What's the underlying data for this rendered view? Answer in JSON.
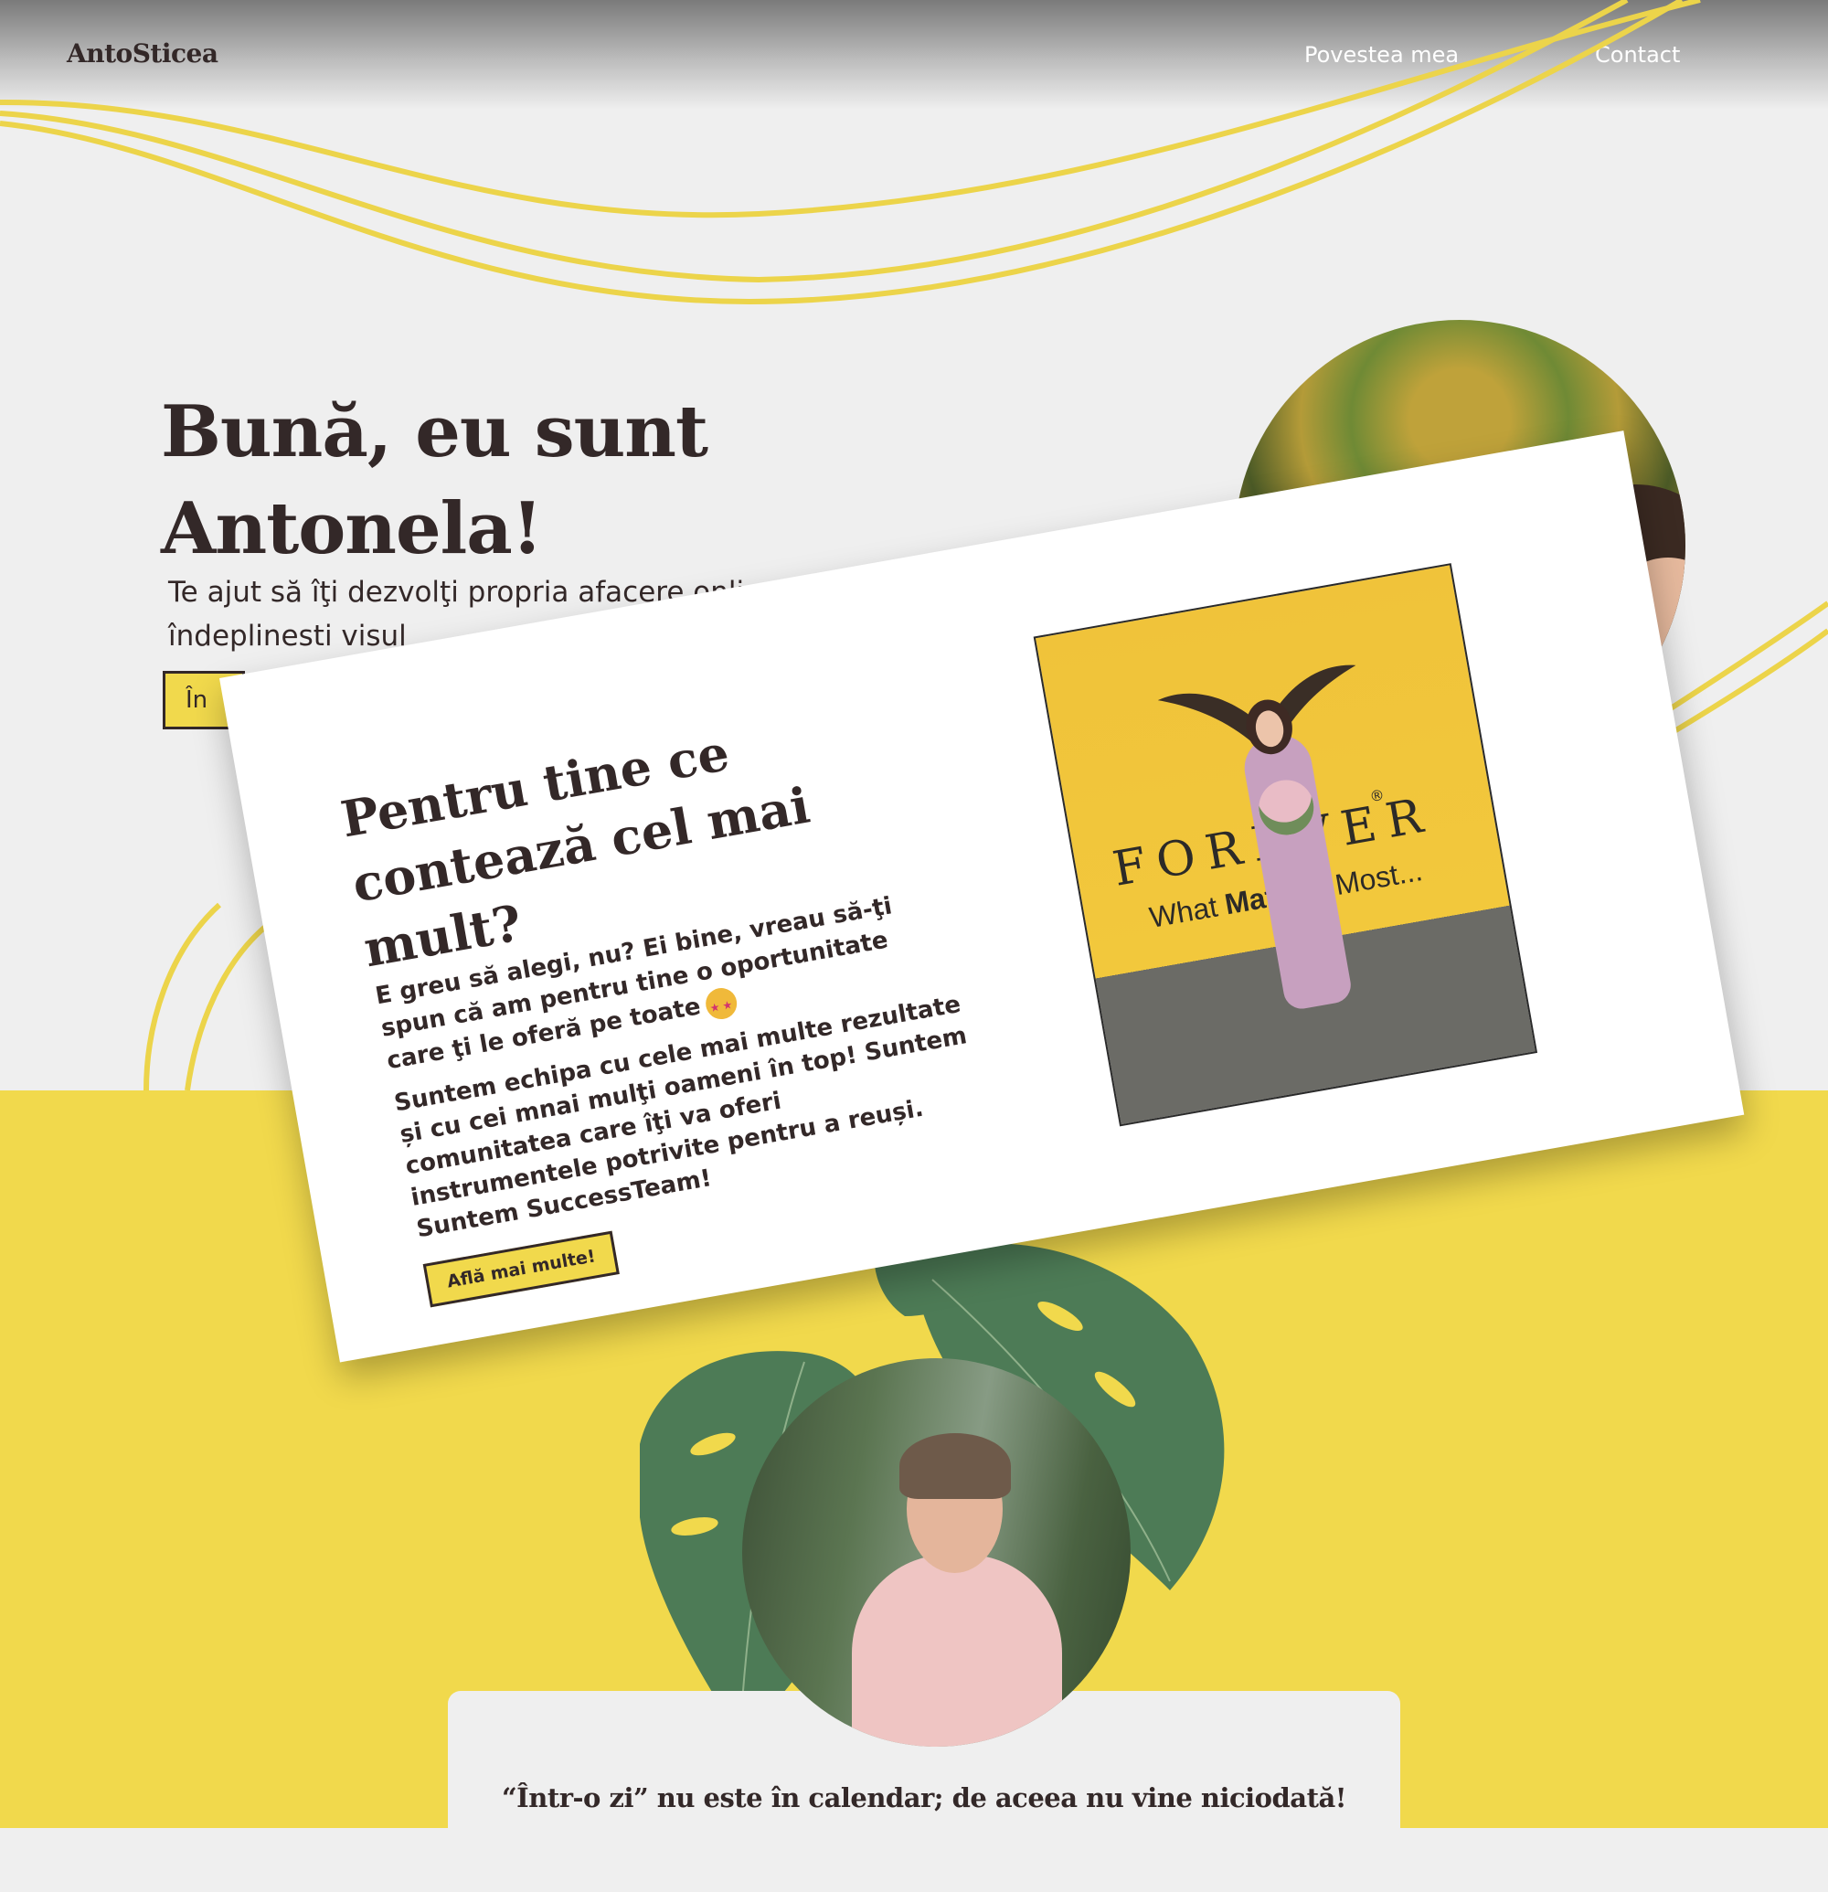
{
  "header": {
    "logo": "AntoSticea",
    "nav": [
      "Povestea mea",
      "Contact"
    ]
  },
  "hero": {
    "title": "Bună, eu sunt Antonela!",
    "subtitle_visible": "Te ajut să îţi dezvolţi propria afacere onli... să îţi îndeplinesti visul",
    "button_visible": "În"
  },
  "modal": {
    "title": "Pentru tine ce contează cel mai mult?",
    "paragraph1": "E greu să alegi, nu? Ei bine, vreau să-ţi spun că am pentru tine o oportunitate care ţi le oferă pe toate",
    "paragraph2": "Suntem echipa cu cele mai multe rezultate și cu cei mnai mulţi oameni în top! Suntem comunitatea care îţi va oferi instrumentele potrivite pentru a reuși. Suntem SuccessTeam!",
    "button": "Află mai multe!",
    "photo": {
      "brand": "FOREVER",
      "registered": "®",
      "tagline_pre": "What ",
      "tagline_bold": "Matters",
      "tagline_post": " Most..."
    }
  },
  "quote": "“Într-o zi” nu este în calendar; de aceea nu vine niciodată!",
  "colors": {
    "accent_yellow": "#f1d94c",
    "dark_text": "#332828",
    "background": "#efefef",
    "leaf_green": "#4d7b56"
  },
  "icons": [
    "star-struck-emoji-icon",
    "eagle-logo-icon"
  ]
}
